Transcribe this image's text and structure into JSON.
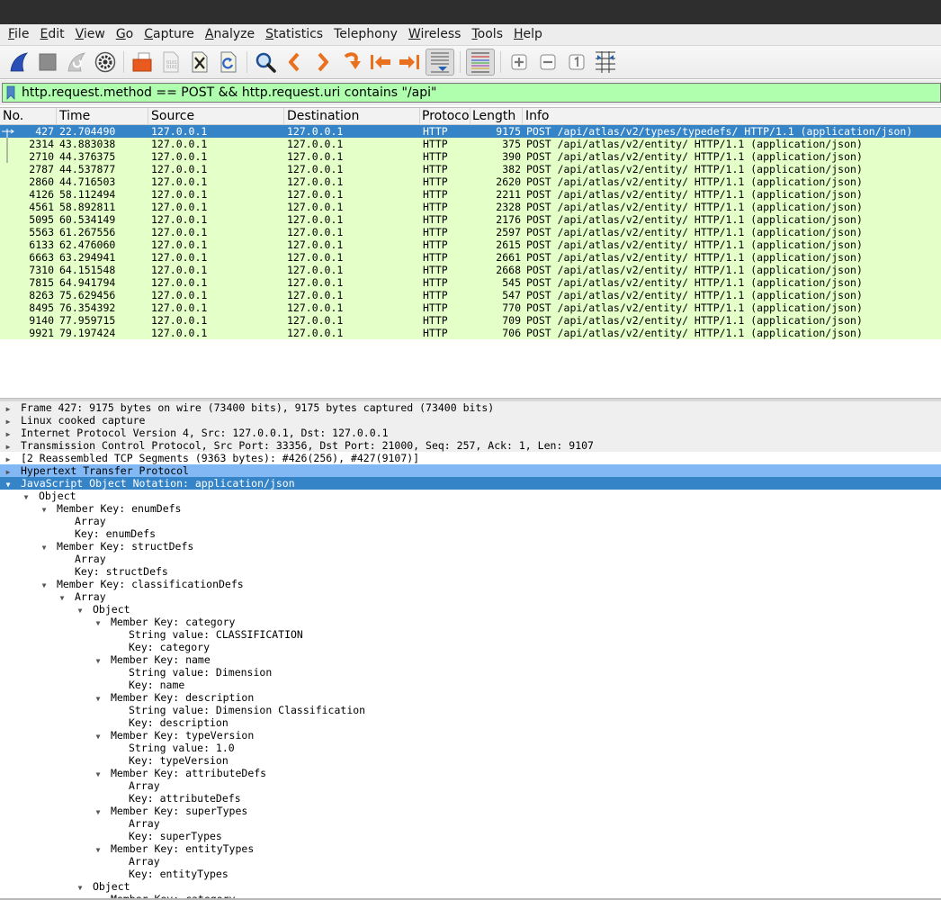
{
  "menubar": {
    "items": [
      {
        "label": "File",
        "mnemonic": "F",
        "rest": "ile"
      },
      {
        "label": "Edit",
        "mnemonic": "E",
        "rest": "dit"
      },
      {
        "label": "View",
        "mnemonic": "V",
        "rest": "iew"
      },
      {
        "label": "Go",
        "mnemonic": "G",
        "rest": "o"
      },
      {
        "label": "Capture",
        "mnemonic": "C",
        "rest": "apture"
      },
      {
        "label": "Analyze",
        "mnemonic": "A",
        "rest": "nalyze"
      },
      {
        "label": "Statistics",
        "mnemonic": "S",
        "rest": "tatistics"
      },
      {
        "label": "Telephony",
        "mnemonic": "",
        "rest": "Telephony"
      },
      {
        "label": "Wireless",
        "mnemonic": "W",
        "rest": "ireless"
      },
      {
        "label": "Tools",
        "mnemonic": "T",
        "rest": "ools"
      },
      {
        "label": "Help",
        "mnemonic": "H",
        "rest": "elp"
      }
    ]
  },
  "toolbar": {
    "buttons": [
      {
        "name": "start-capture-icon"
      },
      {
        "name": "stop-capture-icon"
      },
      {
        "name": "restart-capture-icon"
      },
      {
        "name": "capture-options-icon"
      },
      {
        "name": "open-file-icon"
      },
      {
        "name": "save-file-icon"
      },
      {
        "name": "close-file-icon"
      },
      {
        "name": "reload-file-icon"
      },
      {
        "name": "find-packet-icon"
      },
      {
        "name": "go-back-icon"
      },
      {
        "name": "go-forward-icon"
      },
      {
        "name": "go-to-packet-icon"
      },
      {
        "name": "go-first-packet-icon"
      },
      {
        "name": "go-last-packet-icon"
      },
      {
        "name": "auto-scroll-icon"
      },
      {
        "name": "colorize-icon"
      },
      {
        "name": "zoom-in-icon"
      },
      {
        "name": "zoom-out-icon"
      },
      {
        "name": "normal-size-icon"
      },
      {
        "name": "resize-columns-icon"
      }
    ]
  },
  "filter": {
    "value": "http.request.method == POST && http.request.uri contains \"/api\"",
    "color": "#afffaf"
  },
  "packet_list": {
    "columns": [
      "No.",
      "Time",
      "Source",
      "Destination",
      "Protoco",
      "Length",
      "Info"
    ],
    "rows": [
      {
        "no": "427",
        "time": "22.704490",
        "src": "127.0.0.1",
        "dst": "127.0.0.1",
        "proto": "HTTP",
        "len": "9175",
        "info": "POST /api/atlas/v2/types/typedefs/ HTTP/1.1  (application/json)",
        "selected": true
      },
      {
        "no": "2314",
        "time": "43.883038",
        "src": "127.0.0.1",
        "dst": "127.0.0.1",
        "proto": "HTTP",
        "len": "375",
        "info": "POST /api/atlas/v2/entity/ HTTP/1.1  (application/json)"
      },
      {
        "no": "2710",
        "time": "44.376375",
        "src": "127.0.0.1",
        "dst": "127.0.0.1",
        "proto": "HTTP",
        "len": "390",
        "info": "POST /api/atlas/v2/entity/ HTTP/1.1  (application/json)"
      },
      {
        "no": "2787",
        "time": "44.537877",
        "src": "127.0.0.1",
        "dst": "127.0.0.1",
        "proto": "HTTP",
        "len": "382",
        "info": "POST /api/atlas/v2/entity/ HTTP/1.1  (application/json)"
      },
      {
        "no": "2860",
        "time": "44.716503",
        "src": "127.0.0.1",
        "dst": "127.0.0.1",
        "proto": "HTTP",
        "len": "2620",
        "info": "POST /api/atlas/v2/entity/ HTTP/1.1  (application/json)"
      },
      {
        "no": "4126",
        "time": "58.112494",
        "src": "127.0.0.1",
        "dst": "127.0.0.1",
        "proto": "HTTP",
        "len": "2211",
        "info": "POST /api/atlas/v2/entity/ HTTP/1.1  (application/json)"
      },
      {
        "no": "4561",
        "time": "58.892811",
        "src": "127.0.0.1",
        "dst": "127.0.0.1",
        "proto": "HTTP",
        "len": "2328",
        "info": "POST /api/atlas/v2/entity/ HTTP/1.1  (application/json)"
      },
      {
        "no": "5095",
        "time": "60.534149",
        "src": "127.0.0.1",
        "dst": "127.0.0.1",
        "proto": "HTTP",
        "len": "2176",
        "info": "POST /api/atlas/v2/entity/ HTTP/1.1  (application/json)"
      },
      {
        "no": "5563",
        "time": "61.267556",
        "src": "127.0.0.1",
        "dst": "127.0.0.1",
        "proto": "HTTP",
        "len": "2597",
        "info": "POST /api/atlas/v2/entity/ HTTP/1.1  (application/json)"
      },
      {
        "no": "6133",
        "time": "62.476060",
        "src": "127.0.0.1",
        "dst": "127.0.0.1",
        "proto": "HTTP",
        "len": "2615",
        "info": "POST /api/atlas/v2/entity/ HTTP/1.1  (application/json)"
      },
      {
        "no": "6663",
        "time": "63.294941",
        "src": "127.0.0.1",
        "dst": "127.0.0.1",
        "proto": "HTTP",
        "len": "2661",
        "info": "POST /api/atlas/v2/entity/ HTTP/1.1  (application/json)"
      },
      {
        "no": "7310",
        "time": "64.151548",
        "src": "127.0.0.1",
        "dst": "127.0.0.1",
        "proto": "HTTP",
        "len": "2668",
        "info": "POST /api/atlas/v2/entity/ HTTP/1.1  (application/json)"
      },
      {
        "no": "7815",
        "time": "64.941794",
        "src": "127.0.0.1",
        "dst": "127.0.0.1",
        "proto": "HTTP",
        "len": "545",
        "info": "POST /api/atlas/v2/entity/ HTTP/1.1  (application/json)"
      },
      {
        "no": "8263",
        "time": "75.629456",
        "src": "127.0.0.1",
        "dst": "127.0.0.1",
        "proto": "HTTP",
        "len": "547",
        "info": "POST /api/atlas/v2/entity/ HTTP/1.1  (application/json)"
      },
      {
        "no": "8495",
        "time": "76.354392",
        "src": "127.0.0.1",
        "dst": "127.0.0.1",
        "proto": "HTTP",
        "len": "770",
        "info": "POST /api/atlas/v2/entity/ HTTP/1.1  (application/json)"
      },
      {
        "no": "9140",
        "time": "77.959715",
        "src": "127.0.0.1",
        "dst": "127.0.0.1",
        "proto": "HTTP",
        "len": "709",
        "info": "POST /api/atlas/v2/entity/ HTTP/1.1  (application/json)"
      },
      {
        "no": "9921",
        "time": "79.197424",
        "src": "127.0.0.1",
        "dst": "127.0.0.1",
        "proto": "HTTP",
        "len": "706",
        "info": "POST /api/atlas/v2/entity/ HTTP/1.1  (application/json)"
      }
    ]
  },
  "details": {
    "rows": [
      {
        "text": "Frame 427: 9175 bytes on wire (73400 bits), 9175 bytes captured (73400 bits)",
        "level": 0,
        "arrow": "collapsed",
        "style": "grey"
      },
      {
        "text": "Linux cooked capture",
        "level": 0,
        "arrow": "collapsed",
        "style": "grey"
      },
      {
        "text": "Internet Protocol Version 4, Src: 127.0.0.1, Dst: 127.0.0.1",
        "level": 0,
        "arrow": "collapsed",
        "style": "grey"
      },
      {
        "text": "Transmission Control Protocol, Src Port: 33356, Dst Port: 21000, Seq: 257, Ack: 1, Len: 9107",
        "level": 0,
        "arrow": "collapsed",
        "style": "grey"
      },
      {
        "text": "[2 Reassembled TCP Segments (9363 bytes): #426(256), #427(9107)]",
        "level": 0,
        "arrow": "collapsed",
        "style": "plain"
      },
      {
        "text": "Hypertext Transfer Protocol",
        "level": 0,
        "arrow": "collapsed",
        "style": "http"
      },
      {
        "text": "JavaScript Object Notation: application/json",
        "level": 0,
        "arrow": "expanded",
        "style": "sel"
      },
      {
        "text": "Object",
        "level": 1,
        "arrow": "expanded"
      },
      {
        "text": "Member Key: enumDefs",
        "level": 2,
        "arrow": "expanded"
      },
      {
        "text": "Array",
        "level": 3,
        "arrow": "none"
      },
      {
        "text": "Key: enumDefs",
        "level": 3,
        "arrow": "none"
      },
      {
        "text": "Member Key: structDefs",
        "level": 2,
        "arrow": "expanded"
      },
      {
        "text": "Array",
        "level": 3,
        "arrow": "none"
      },
      {
        "text": "Key: structDefs",
        "level": 3,
        "arrow": "none"
      },
      {
        "text": "Member Key: classificationDefs",
        "level": 2,
        "arrow": "expanded"
      },
      {
        "text": "Array",
        "level": 3,
        "arrow": "expanded"
      },
      {
        "text": "Object",
        "level": 4,
        "arrow": "expanded"
      },
      {
        "text": "Member Key: category",
        "level": 5,
        "arrow": "expanded"
      },
      {
        "text": "String value: CLASSIFICATION",
        "level": 6,
        "arrow": "none"
      },
      {
        "text": "Key: category",
        "level": 6,
        "arrow": "none"
      },
      {
        "text": "Member Key: name",
        "level": 5,
        "arrow": "expanded"
      },
      {
        "text": "String value: Dimension",
        "level": 6,
        "arrow": "none"
      },
      {
        "text": "Key: name",
        "level": 6,
        "arrow": "none"
      },
      {
        "text": "Member Key: description",
        "level": 5,
        "arrow": "expanded"
      },
      {
        "text": "String value: Dimension Classification",
        "level": 6,
        "arrow": "none"
      },
      {
        "text": "Key: description",
        "level": 6,
        "arrow": "none"
      },
      {
        "text": "Member Key: typeVersion",
        "level": 5,
        "arrow": "expanded"
      },
      {
        "text": "String value: 1.0",
        "level": 6,
        "arrow": "none"
      },
      {
        "text": "Key: typeVersion",
        "level": 6,
        "arrow": "none"
      },
      {
        "text": "Member Key: attributeDefs",
        "level": 5,
        "arrow": "expanded"
      },
      {
        "text": "Array",
        "level": 6,
        "arrow": "none"
      },
      {
        "text": "Key: attributeDefs",
        "level": 6,
        "arrow": "none"
      },
      {
        "text": "Member Key: superTypes",
        "level": 5,
        "arrow": "expanded"
      },
      {
        "text": "Array",
        "level": 6,
        "arrow": "none"
      },
      {
        "text": "Key: superTypes",
        "level": 6,
        "arrow": "none"
      },
      {
        "text": "Member Key: entityTypes",
        "level": 5,
        "arrow": "expanded"
      },
      {
        "text": "Array",
        "level": 6,
        "arrow": "none"
      },
      {
        "text": "Key: entityTypes",
        "level": 6,
        "arrow": "none"
      },
      {
        "text": "Object",
        "level": 4,
        "arrow": "expanded"
      },
      {
        "text": "Member Key: category",
        "level": 5,
        "arrow": "expanded"
      }
    ]
  }
}
